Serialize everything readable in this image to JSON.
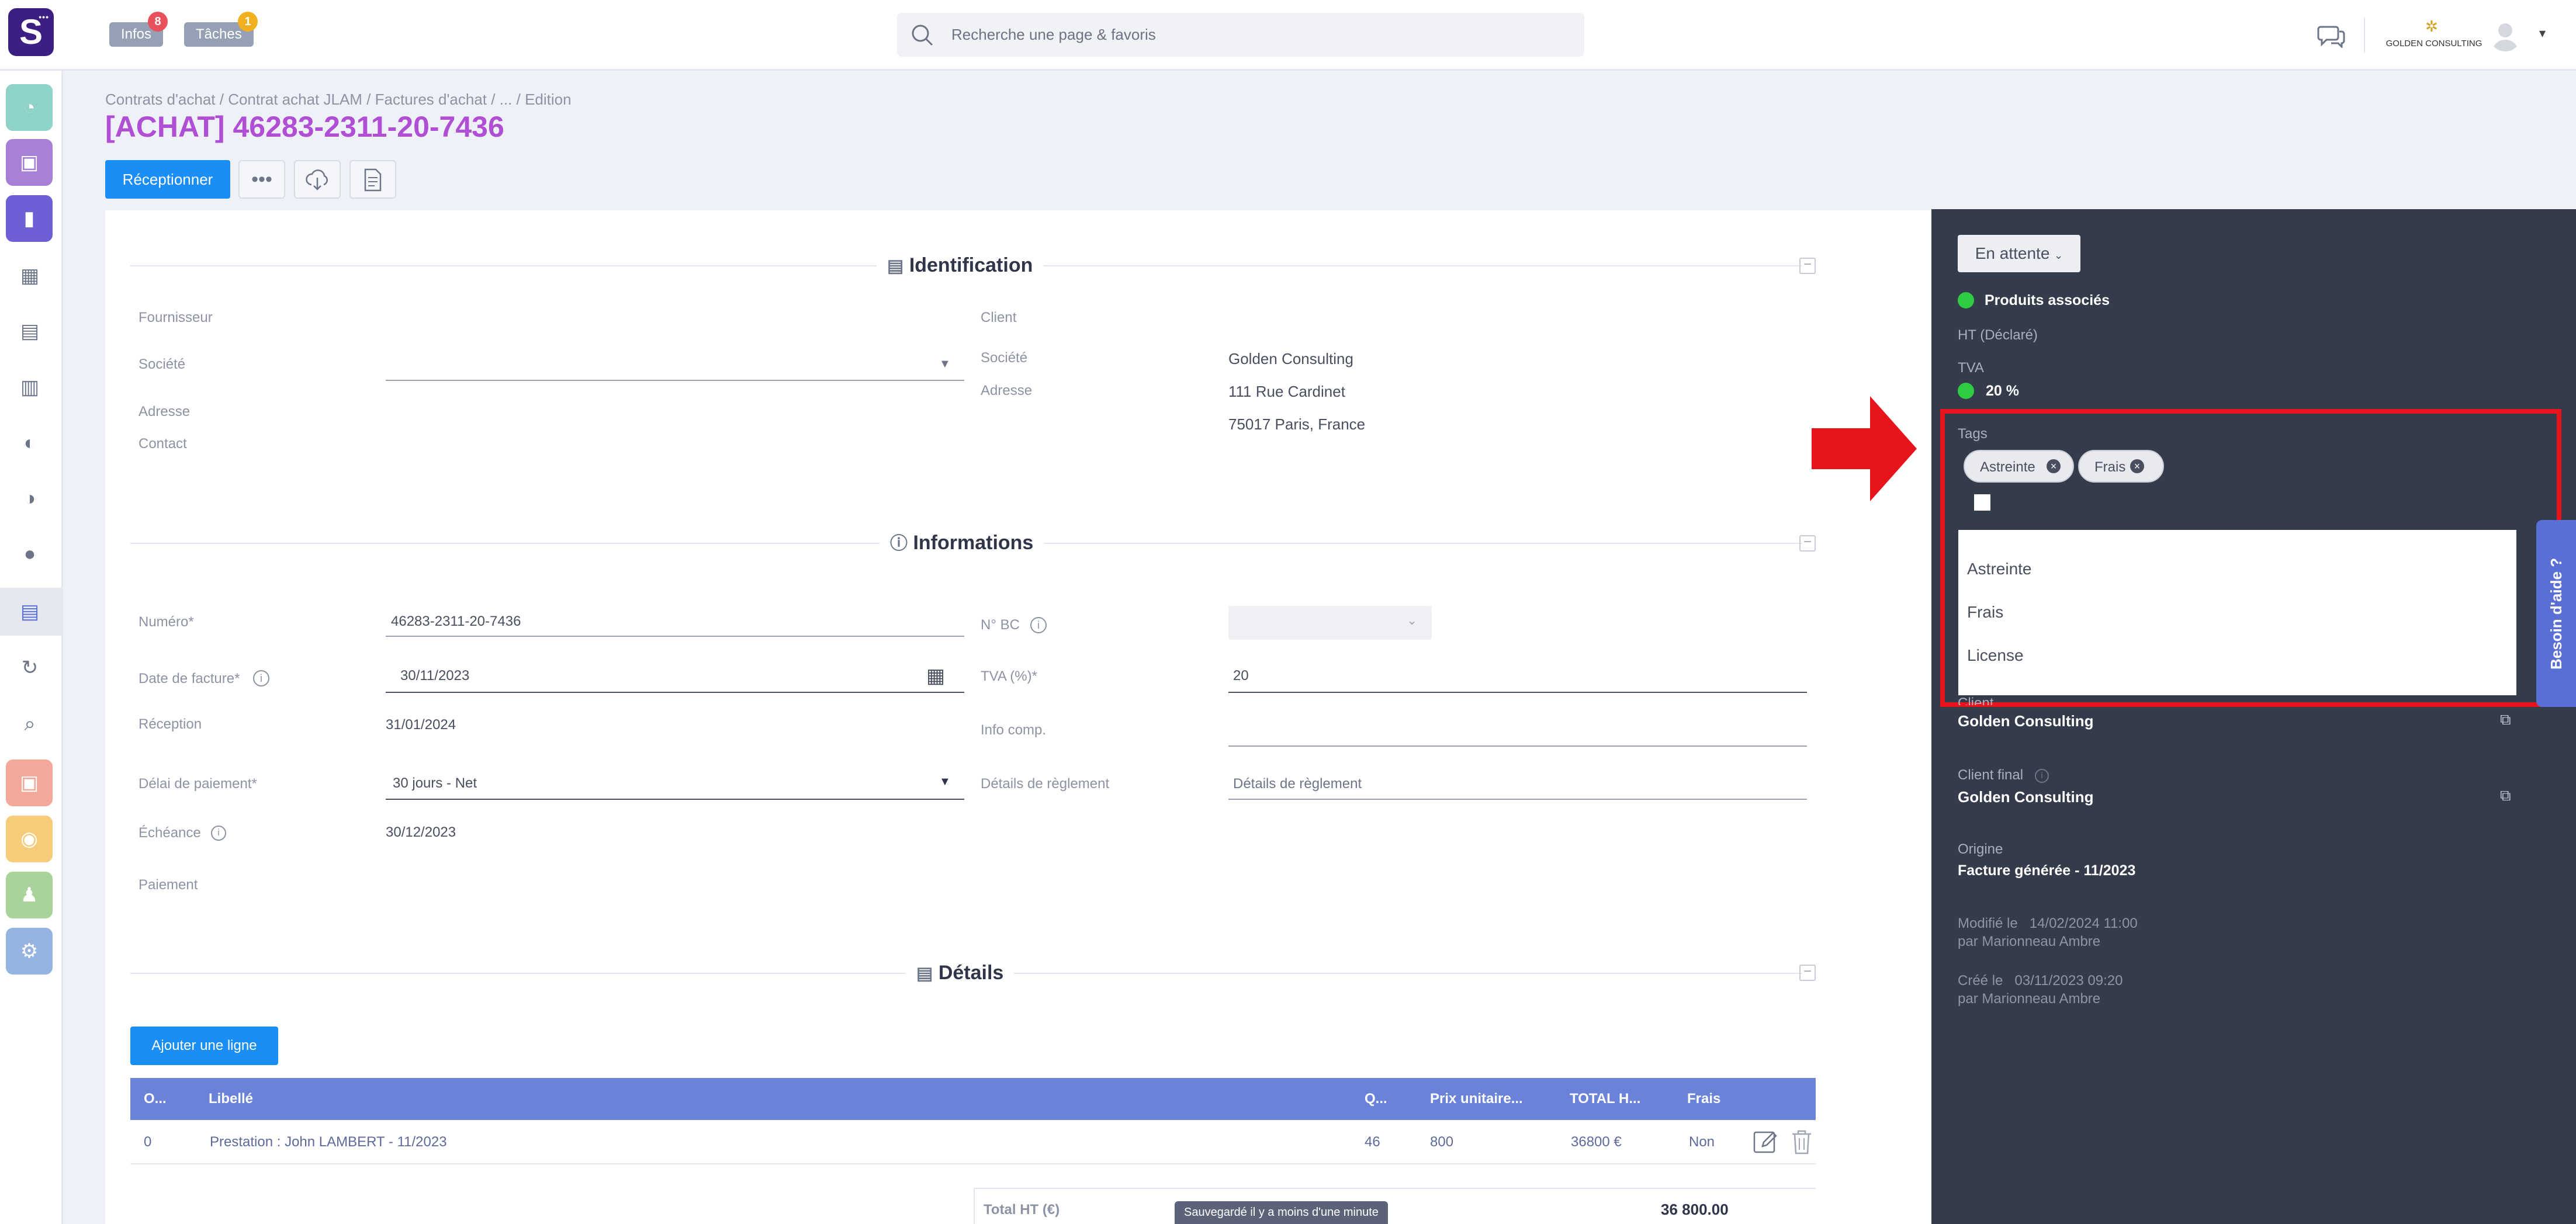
{
  "topbar": {
    "logo_letter": "S",
    "infos_label": "Infos",
    "infos_count": "8",
    "taches_label": "Tâches",
    "taches_count": "1",
    "search_placeholder": "Recherche une page & favoris",
    "company_name": "GOLDEN CONSULTING",
    "user_menu_caret": "▾"
  },
  "breadcrumb": [
    "Contrats d'achat",
    "Contrat achat JLAM",
    "Factures d'achat",
    "...",
    "Edition"
  ],
  "page_title": "[ACHAT] 46283-2311-20-7436",
  "toolbar": {
    "primary_label": "Réceptionner",
    "more_label": "•••"
  },
  "identification": {
    "title": "Identification",
    "fournisseur_label": "Fournisseur",
    "societe_label": "Société",
    "adresse_label": "Adresse",
    "contact_label": "Contact",
    "client_label": "Client",
    "client_societe_label": "Société",
    "client_societe_value": "Golden Consulting",
    "client_adresse_label": "Adresse",
    "client_adresse_line1": "111 Rue Cardinet",
    "client_adresse_line2": "75017 Paris, France"
  },
  "informations": {
    "title": "Informations",
    "numero_label": "Numéro*",
    "numero_value": "46283-2311-20-7436",
    "date_label": "Date de facture*",
    "date_value": "30/11/2023",
    "reception_label": "Réception",
    "reception_value": "31/01/2024",
    "delai_label": "Délai de paiement*",
    "delai_value": "30 jours - Net",
    "echeance_label": "Échéance",
    "echeance_value": "30/12/2023",
    "paiement_label": "Paiement",
    "nbc_label": "N° BC",
    "tva_label": "TVA (%)*",
    "tva_value": "20",
    "infocomp_label": "Info comp.",
    "details_reglement_label": "Détails de règlement",
    "details_reglement_placeholder": "Détails de règlement"
  },
  "details": {
    "title": "Détails",
    "add_line_label": "Ajouter une ligne",
    "columns": [
      "O...",
      "Libellé",
      "Q...",
      "Prix unitaire...",
      "TOTAL H...",
      "Frais"
    ],
    "rows": [
      {
        "order": "0",
        "libelle": "Prestation : John LAMBERT - 11/2023",
        "qty": "46",
        "prix": "800",
        "total": "36800 €",
        "frais": "Non"
      }
    ],
    "total_label": "Total HT (€)",
    "total_value": "36 800.00",
    "saved_toast": "Sauvegardé il y a moins d'une minute"
  },
  "panel": {
    "status_label": "En attente",
    "produits_label": "Produits associés",
    "ht_label": "HT (Déclaré)",
    "tva_label": "TVA",
    "tva_value": "20 %",
    "tags_label": "Tags",
    "tags": [
      "Astreinte",
      "Frais"
    ],
    "tag_options": [
      "Astreinte",
      "Frais",
      "License"
    ],
    "client_label": "Client",
    "client_value": "Golden Consulting",
    "client_final_label": "Client final",
    "client_final_value": "Golden Consulting",
    "origine_label": "Origine",
    "origine_value": "Facture générée - 11/2023",
    "modifie_line1": "Modifié le   14/02/2024 11:00",
    "modifie_line2": "par Marionneau Ambre",
    "cree_line1": "Créé le   03/11/2023 09:20",
    "cree_line2": "par Marionneau Ambre"
  },
  "help_tab": "Besoin d'aide ?",
  "colors": {
    "brand_purple": "#3d1e82",
    "title_purple": "#b04ed6",
    "primary_blue": "#1a8ef5",
    "table_header": "#6b82d9",
    "panel_dark": "#343b4b",
    "highlight_red": "#e8141c",
    "status_green": "#2ecc40"
  },
  "icons": [
    "search-icon",
    "chat-icon",
    "avatar-icon",
    "download-cloud-icon",
    "document-icon",
    "calendar-icon",
    "info-icon",
    "edit-icon",
    "trash-icon",
    "external-link-icon",
    "remove-tag-icon"
  ]
}
